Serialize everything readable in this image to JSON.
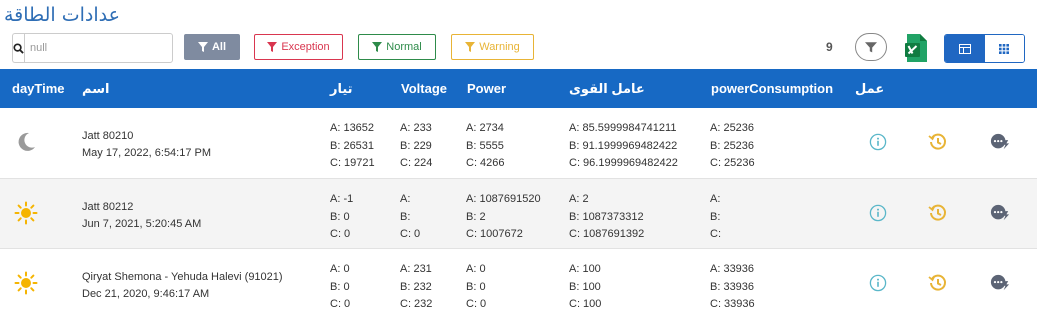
{
  "page": {
    "title": "عدادات الطاقة"
  },
  "search": {
    "placeholder": "null",
    "value": ""
  },
  "filters": {
    "all": "All",
    "exception": "Exception",
    "normal": "Normal",
    "warning": "Warning"
  },
  "toolbar": {
    "count": "9"
  },
  "colors": {
    "header_bg": "#1769c4",
    "exception": "#d9364f",
    "normal": "#2e8b4a",
    "warning": "#e8b436",
    "info": "#5ab7c9",
    "history": "#e8b436"
  },
  "table": {
    "headers": {
      "daytime": "dayTime",
      "name": "اسم",
      "current": "تيار",
      "voltage": "Voltage",
      "power": "Power",
      "power_factor": "عامل القوى",
      "consumption": "powerConsumption",
      "action": "عمل"
    },
    "rows": [
      {
        "daytime_icon": "moon-icon",
        "name": "Jatt 80210",
        "date": "May 17, 2022, 6:54:17 PM",
        "current": [
          "A: 13652",
          "B: 26531",
          "C: 19721"
        ],
        "voltage": [
          "A: 233",
          "B: 229",
          "C: 224"
        ],
        "power": [
          "A: 2734",
          "B: 5555",
          "C: 4266"
        ],
        "power_factor": [
          "A: 85.5999984741211",
          "B: 91.1999969482422",
          "C: 96.1999969482422"
        ],
        "consumption": [
          "A: 25236",
          "B: 25236",
          "C: 25236"
        ]
      },
      {
        "daytime_icon": "sun-icon",
        "name": "Jatt 80212",
        "date": "Jun 7, 2021, 5:20:45 AM",
        "current": [
          "A: -1",
          "B: 0",
          "C: 0"
        ],
        "voltage": [
          "A:",
          "B:",
          "C: 0"
        ],
        "power": [
          "A: 1087691520",
          "B: 2",
          "C: 1007672"
        ],
        "power_factor": [
          "A: 2",
          "B: 1087373312",
          "C: 1087691392"
        ],
        "consumption": [
          "A:",
          "B:",
          "C:"
        ]
      },
      {
        "daytime_icon": "sun-icon",
        "name": "Qiryat Shemona - Yehuda Halevi (91021)",
        "date": "Dec 21, 2020, 9:46:17 AM",
        "current": [
          "A: 0",
          "B: 0",
          "C: 0"
        ],
        "voltage": [
          "A: 231",
          "B: 232",
          "C: 232"
        ],
        "power": [
          "A: 0",
          "B: 0",
          "C: 0"
        ],
        "power_factor": [
          "A: 100",
          "B: 100",
          "C: 100"
        ],
        "consumption": [
          "A: 33936",
          "B: 33936",
          "C: 33936"
        ]
      }
    ]
  }
}
